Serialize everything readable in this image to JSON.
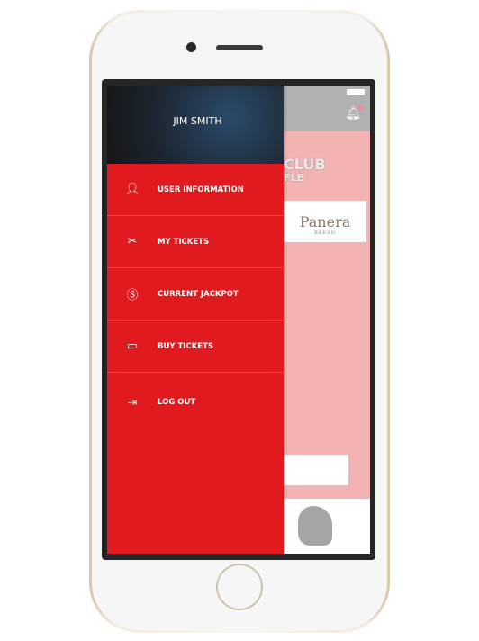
{
  "drawer": {
    "user_name": "JIM SMITH",
    "items": [
      {
        "label": "USER INFORMATION",
        "icon": "user-icon"
      },
      {
        "label": "MY TICKETS",
        "icon": "ticket-icon"
      },
      {
        "label": "CURRENT JACKPOT",
        "icon": "dollar-icon"
      },
      {
        "label": "BUY TICKETS",
        "icon": "buy-ticket-icon"
      },
      {
        "label": "LOG OUT",
        "icon": "logout-icon"
      }
    ]
  },
  "background": {
    "club": "CLUB",
    "raffle": "FLE",
    "sponsor": "Panera",
    "sponsor_sub": "BREAD",
    "notification_count": "1"
  },
  "colors": {
    "accent": "#e01a1f",
    "header_gray": "#b1b1b1"
  }
}
